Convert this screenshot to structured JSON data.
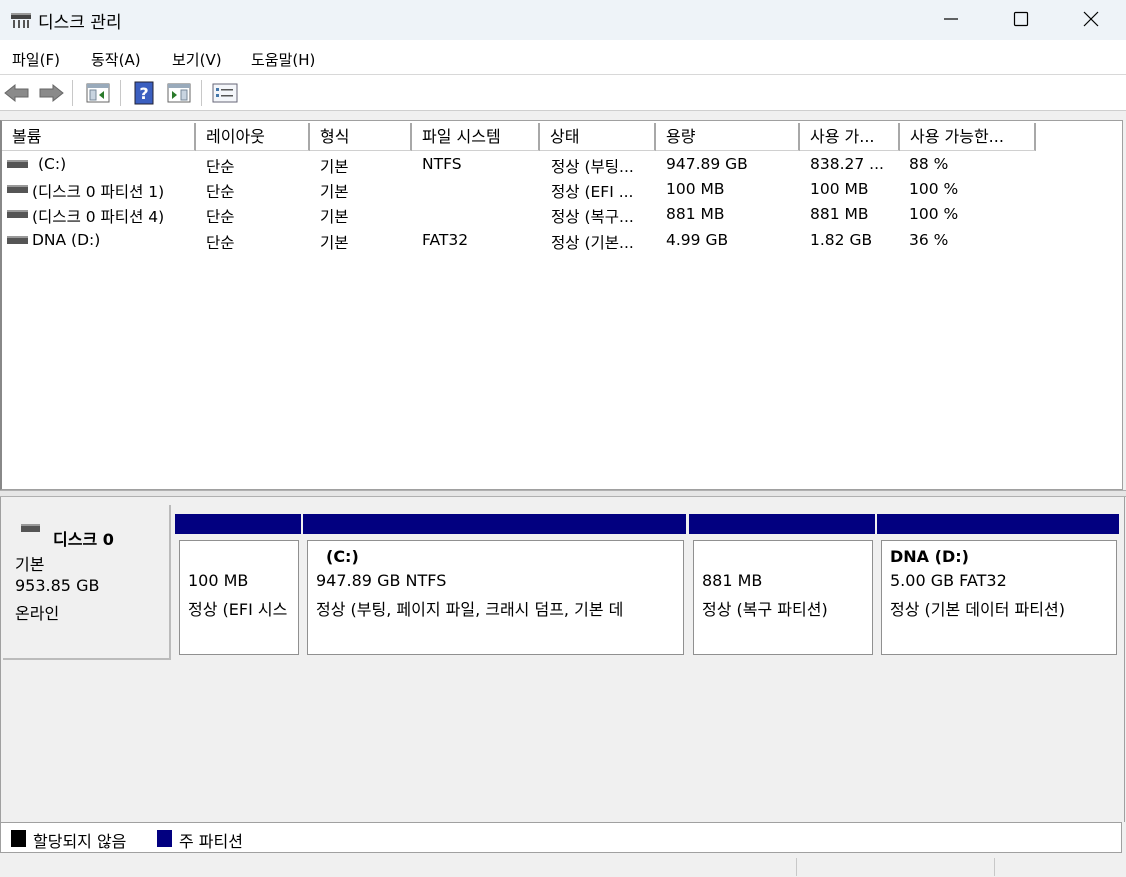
{
  "window": {
    "title": "디스크 관리",
    "icon": "disk-management-icon"
  },
  "menu": [
    "파일(F)",
    "동작(A)",
    "보기(V)",
    "도움말(H)"
  ],
  "toolbar": [
    "back-arrow-icon",
    "forward-arrow-icon",
    "show-hide-console-tree-icon",
    "help-icon",
    "show-hide-action-pane-icon",
    "properties-icon"
  ],
  "volume_list": {
    "columns": [
      "볼륨",
      "레이아웃",
      "형식",
      "파일 시스템",
      "상태",
      "용량",
      "사용 가...",
      "사용 가능한..."
    ],
    "rows": [
      {
        "volume": "(C:)",
        "layout": "단순",
        "type": "기본",
        "fs": "NTFS",
        "status": "정상 (부팅...",
        "capacity": "947.89 GB",
        "free": "838.27 ...",
        "pct": "88 %"
      },
      {
        "volume": "(디스크 0 파티션 1)",
        "layout": "단순",
        "type": "기본",
        "fs": "",
        "status": "정상 (EFI ...",
        "capacity": "100 MB",
        "free": "100 MB",
        "pct": "100 %"
      },
      {
        "volume": "(디스크 0 파티션 4)",
        "layout": "단순",
        "type": "기본",
        "fs": "",
        "status": "정상 (복구...",
        "capacity": "881 MB",
        "free": "881 MB",
        "pct": "100 %"
      },
      {
        "volume": "DNA (D:)",
        "layout": "단순",
        "type": "기본",
        "fs": "FAT32",
        "status": "정상 (기본...",
        "capacity": "4.99 GB",
        "free": "1.82 GB",
        "pct": "36 %"
      }
    ]
  },
  "disk": {
    "name": "디스크 0",
    "type": "기본",
    "size": "953.85 GB",
    "state": "온라인",
    "partitions": [
      {
        "name": "",
        "size": "100 MB",
        "status": "정상 (EFI 시스"
      },
      {
        "name": "(C:)",
        "size": "947.89 GB NTFS",
        "status": "정상 (부팅, 페이지 파일, 크래시 덤프, 기본 데"
      },
      {
        "name": "",
        "size": "881 MB",
        "status": "정상 (복구 파티션)"
      },
      {
        "name": "DNA  (D:)",
        "size": "5.00 GB FAT32",
        "status": "정상 (기본 데이터 파티션)"
      }
    ]
  },
  "legend": [
    {
      "label": "할당되지 않음",
      "color": "#000000"
    },
    {
      "label": "주 파티션",
      "color": "#020080"
    }
  ]
}
